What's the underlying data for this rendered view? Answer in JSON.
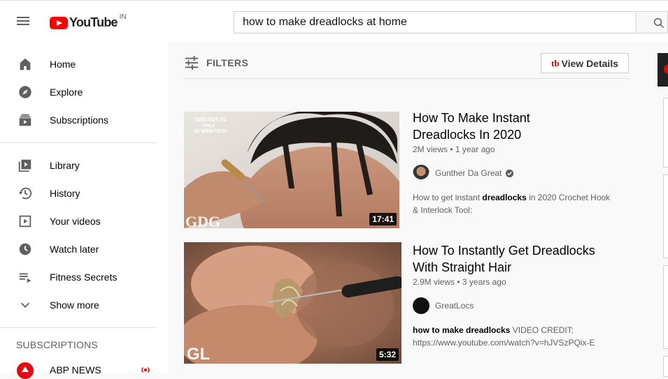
{
  "header": {
    "logo_text": "YouTube",
    "country_code": "IN",
    "search_value": "how to make dreadlocks at home"
  },
  "sidebar": {
    "primary": [
      {
        "label": "Home",
        "icon": "home-icon"
      },
      {
        "label": "Explore",
        "icon": "compass-icon"
      },
      {
        "label": "Subscriptions",
        "icon": "subscriptions-icon"
      }
    ],
    "secondary": [
      {
        "label": "Library",
        "icon": "library-icon"
      },
      {
        "label": "History",
        "icon": "history-icon"
      },
      {
        "label": "Your videos",
        "icon": "your-videos-icon"
      },
      {
        "label": "Watch later",
        "icon": "clock-icon"
      },
      {
        "label": "Fitness Secrets",
        "icon": "playlist-icon"
      },
      {
        "label": "Show more",
        "icon": "chevron-down-icon"
      }
    ],
    "subscriptions_title": "SUBSCRIPTIONS",
    "subscriptions": [
      {
        "name": "ABP NEWS",
        "live": true
      }
    ]
  },
  "toolbar": {
    "filters_label": "FILTERS",
    "view_details_label": "View Details",
    "view_details_brand": "tb"
  },
  "results": [
    {
      "title_line1": "How To Make Instant",
      "title_line2": "Dreadlocks In 2020",
      "views": "2M views",
      "age": "1 year ago",
      "channel": "Gunther Da Great",
      "verified": true,
      "desc_line1_pre": "How to get instant ",
      "desc_line1_bold": "dreadlocks",
      "desc_line1_post": " in 2020 Crochet Hook",
      "desc_line2": "& Interlock Tool:",
      "duration": "17:41",
      "thumb_overlay": "DREADS IN ONLY 10 MINUTES!",
      "thumb_watermark": "GDG"
    },
    {
      "title_line1": "How To Instantly Get Dreadlocks",
      "title_line2": "With Straight Hair",
      "views": "2.9M views",
      "age": "3 years ago",
      "channel": "GreatLocs",
      "verified": false,
      "desc_line1_bold": "how to make dreadlocks",
      "desc_line1_post": " VIDEO CREDIT:",
      "desc_line2": "https://www.youtube.com/watch?v=hJVSzPQix-E",
      "duration": "5:32",
      "thumb_watermark": "GL"
    }
  ]
}
